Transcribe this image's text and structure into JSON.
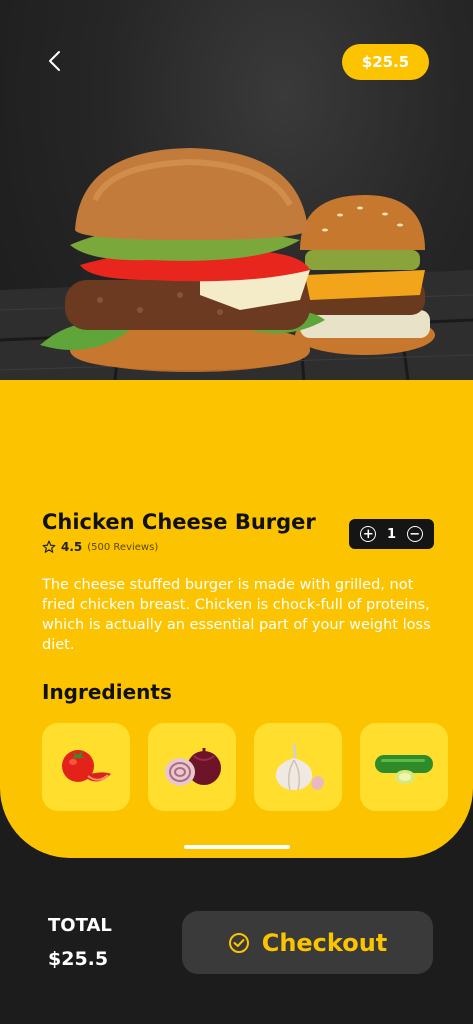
{
  "header": {
    "price_badge": "$25.5"
  },
  "product": {
    "title": "Chicken Cheese Burger",
    "rating": "4.5",
    "reviews": "(500 Reviews)",
    "quantity": "1",
    "description": "The cheese stuffed burger is made with grilled, not fried chicken breast. Chicken is chock-full of proteins, which is actually an essential part of your weight loss diet."
  },
  "ingredients": {
    "title": "Ingredients",
    "items": [
      {
        "icon": "tomato-icon"
      },
      {
        "icon": "onion-icon"
      },
      {
        "icon": "garlic-icon"
      },
      {
        "icon": "zucchini-icon"
      }
    ]
  },
  "footer": {
    "total_label": "TOTAL",
    "total_value": "$25.5",
    "checkout_label": "Checkout"
  },
  "colors": {
    "accent": "#fcc400",
    "dark": "#1c1c1c",
    "tile": "#ffde2e",
    "button": "#3a3a3a"
  }
}
